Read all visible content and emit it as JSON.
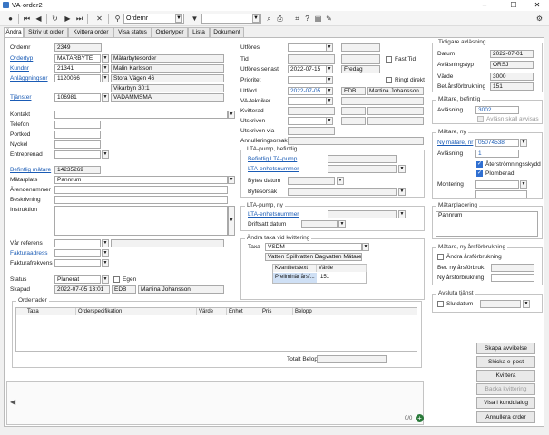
{
  "window": {
    "title": "VA-order2",
    "minimize": "–",
    "maximize": "☐",
    "close": "✕"
  },
  "toolbar": {
    "search_label": "Ordernr",
    "filter_value": ""
  },
  "tabs": [
    {
      "label": "Ändra"
    },
    {
      "label": "Skriv ut order"
    },
    {
      "label": "Kvittera order"
    },
    {
      "label": "Visa status"
    },
    {
      "label": "Ordertyper"
    },
    {
      "label": "Lista"
    },
    {
      "label": "Dokument"
    }
  ],
  "left": {
    "ordernr_label": "Ordernr",
    "ordernr": "2349",
    "ordertyp_label": "Ordertyp",
    "ordertyp_code": "MÄTARBYTE",
    "ordertyp_name": "Mätarbytesorder",
    "kundnr_label": "Kundnr",
    "kundnr": "21341",
    "kund_name": "Malin Karlsson",
    "anl_label": "Anläggningsnr",
    "anl": "1120066",
    "anl_addr": "Stora Vägen 46",
    "anl_area": "Vikarbyn 30:1",
    "tjanster_label": "Tjänster",
    "tjanster": "106981",
    "tjanster_name": "VADÄMMSMÄ",
    "kontakt_label": "Kontakt",
    "telefon_label": "Telefon",
    "portkod_label": "Portkod",
    "nyckel_label": "Nyckel",
    "entreprenad_label": "Entreprenad",
    "matare_label": "Befintlig mätare",
    "matare": "14235269",
    "matarplats_label": "Mätarplats",
    "matarplats": "Pannrum",
    "arendenummer_label": "Ärendenummer",
    "beskrivning_label": "Beskrivning",
    "instruktion_label": "Instruktion",
    "var_referens_label": "Vår referens",
    "fakturaadress_label": "Fakturaadress",
    "fakturafrekvens_label": "Fakturafrekvens",
    "status_label": "Status",
    "status": "Planerat",
    "egen_label": "Egen",
    "skapad_label": "Skapad",
    "skapad": "2022-07-05 13:01",
    "skapad_by": "EDB",
    "skapad_name": "Martina Johansson"
  },
  "middle": {
    "utfores_label": "Utföres",
    "tid_label": "Tid",
    "fast_tid_label": "Fast Tid",
    "utfores_senast_label": "Utföres senast",
    "utfores_senast": "2022-07-15",
    "utfores_senast_day": "Fredag",
    "prioritet_label": "Prioritet",
    "ringt_direkt_label": "Ringt direkt",
    "utford_label": "Utförd",
    "utford": "2022-07-05",
    "utford_by": "EDB",
    "utford_name": "Martina Johansson",
    "va_tekniker_label": "VA-tekniker",
    "kvitterad_label": "Kvitterad",
    "utskriven_label": "Utskriven",
    "utskriven_via_label": "Utskriven via",
    "annullering_label": "Annulleringsorsak",
    "lta_bef_title": "LTA-pump, befintlig",
    "lta_bef_pump_label": "Befintlig LTA-pump",
    "lta_bef_enhet_label": "LTA-enhetsnummer",
    "lta_bef_bytes_label": "Bytes datum",
    "lta_bef_bytesorsak_label": "Bytesorsak",
    "lta_ny_title": "LTA-pump, ny",
    "lta_ny_enhet_label": "LTA-enhetsnummer",
    "lta_ny_drift_label": "Driftsatt datum",
    "taxa_title": "Ändra taxa vid kvittering",
    "taxa_label": "Taxa",
    "taxa": "VSDM",
    "taxa_name": "Vatten Spillvatten Dagvatten Mätare",
    "taxa_col1": "Kvantitetstext",
    "taxa_col2": "Värde",
    "taxa_row_text": "Preliminär årsf...",
    "taxa_row_value": "151"
  },
  "right": {
    "tidigare_title": "Tidigare avläsning",
    "datum_label": "Datum",
    "datum": "2022-07-01",
    "typ_label": "Avläsningstyp",
    "typ": "ORSJ",
    "varde_label": "Värde",
    "varde": "3000",
    "arsforbr_label": "Bet.årsförbrukning",
    "arsforbr": "151",
    "bef_title": "Mätare, befintlig",
    "bef_avl_label": "Avläsning",
    "bef_avl": "3002",
    "bef_avisas_label": "Avläsn.skall avvisas",
    "ny_title": "Mätare, ny",
    "ny_matare_label": "Ny mätare, nr",
    "ny_matare": "05074538",
    "ny_avl_label": "Avläsning",
    "ny_avl": "1",
    "aterstromning_label": "Återströmningsskydd",
    "plomberad_label": "Plomberad",
    "montering_label": "Montering",
    "matarplacering_title": "Mätarplacering",
    "matarplacering": "Pannrum",
    "ny_ars_title": "Mätare, ny årsförbrukning",
    "andra_ars_label": "Ändra årsförbrukning",
    "ber_ars_label": "Ber. ny årsförbruk.",
    "ny_ars_label": "Ny årsförbrukning",
    "avsluta_title": "Avsluta tjänst",
    "slutdatum_label": "Slutdatum"
  },
  "orderrader": {
    "title": "Orderrader",
    "columns": [
      "Taxa",
      "Orderspecifikation",
      "Värde",
      "Enhet",
      "Pris",
      "Belopp"
    ],
    "total_label": "Totalt Belopp:",
    "total": ""
  },
  "buttons": {
    "avvikelse": "Skapa avvikelse",
    "epost": "Skicka e-post",
    "kvittera": "Kvittera",
    "backa": "Backa kvittering",
    "kunddialog": "Visa i kunddialog",
    "annullera": "Annullera order"
  },
  "footer": {
    "counter": "0/0"
  }
}
